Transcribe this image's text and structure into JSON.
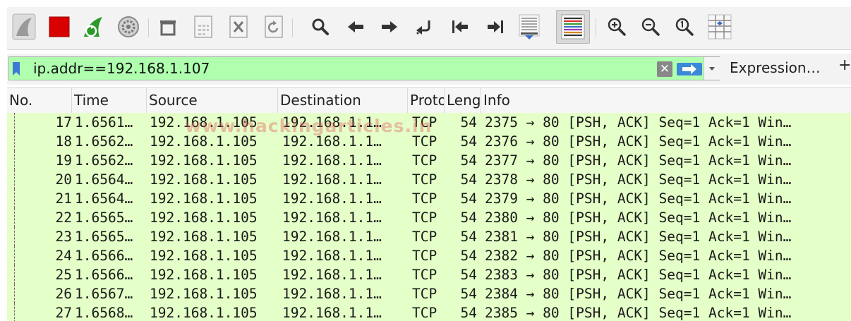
{
  "toolbar": {
    "buttons": [
      {
        "name": "start-capture-button",
        "icon": "shark-fin-icon"
      },
      {
        "name": "stop-capture-button",
        "icon": "stop-square-icon"
      },
      {
        "name": "restart-capture-button",
        "icon": "restart-fin-icon"
      },
      {
        "name": "capture-options-button",
        "icon": "gear-icon"
      },
      {
        "name": "open-file-button",
        "icon": "open-file-icon"
      },
      {
        "name": "save-file-button",
        "icon": "save-file-icon"
      },
      {
        "name": "close-file-button",
        "icon": "close-file-icon"
      },
      {
        "name": "reload-file-button",
        "icon": "reload-file-icon"
      },
      {
        "name": "find-packet-button",
        "icon": "search-icon"
      },
      {
        "name": "go-back-button",
        "icon": "arrow-left-icon"
      },
      {
        "name": "go-forward-button",
        "icon": "arrow-right-icon"
      },
      {
        "name": "go-to-packet-button",
        "icon": "go-to-packet-icon"
      },
      {
        "name": "first-packet-button",
        "icon": "first-packet-icon"
      },
      {
        "name": "last-packet-button",
        "icon": "last-packet-icon"
      },
      {
        "name": "autoscroll-button",
        "icon": "autoscroll-icon"
      },
      {
        "name": "colorize-button",
        "icon": "colorize-icon"
      },
      {
        "name": "zoom-in-button",
        "icon": "zoom-in-icon"
      },
      {
        "name": "zoom-out-button",
        "icon": "zoom-out-icon"
      },
      {
        "name": "normal-size-button",
        "icon": "zoom-reset-icon"
      },
      {
        "name": "resize-columns-button",
        "icon": "resize-columns-icon"
      }
    ],
    "colors": {
      "stop": "#d80000",
      "restart": "#2a9a2a",
      "fin": "#8a8a8a",
      "accent": "#3b6fc4"
    }
  },
  "filter": {
    "value": "ip.addr==192.168.1.107",
    "background": "#afffaf",
    "expression_label": "Expression…",
    "plus_label": "+"
  },
  "columns": [
    "No.",
    "Time",
    "Source",
    "Destination",
    "Proto",
    "Leng",
    "Info"
  ],
  "packets": [
    {
      "no": "17",
      "time": "1.6561…",
      "source": "192.168.1.105",
      "destination": "192.168.1.1…",
      "protocol": "TCP",
      "length": "54",
      "info": "2375 → 80 [PSH, ACK] Seq=1 Ack=1 Win…"
    },
    {
      "no": "18",
      "time": "1.6562…",
      "source": "192.168.1.105",
      "destination": "192.168.1.1…",
      "protocol": "TCP",
      "length": "54",
      "info": "2376 → 80 [PSH, ACK] Seq=1 Ack=1 Win…"
    },
    {
      "no": "19",
      "time": "1.6562…",
      "source": "192.168.1.105",
      "destination": "192.168.1.1…",
      "protocol": "TCP",
      "length": "54",
      "info": "2377 → 80 [PSH, ACK] Seq=1 Ack=1 Win…"
    },
    {
      "no": "20",
      "time": "1.6564…",
      "source": "192.168.1.105",
      "destination": "192.168.1.1…",
      "protocol": "TCP",
      "length": "54",
      "info": "2378 → 80 [PSH, ACK] Seq=1 Ack=1 Win…"
    },
    {
      "no": "21",
      "time": "1.6564…",
      "source": "192.168.1.105",
      "destination": "192.168.1.1…",
      "protocol": "TCP",
      "length": "54",
      "info": "2379 → 80 [PSH, ACK] Seq=1 Ack=1 Win…"
    },
    {
      "no": "22",
      "time": "1.6565…",
      "source": "192.168.1.105",
      "destination": "192.168.1.1…",
      "protocol": "TCP",
      "length": "54",
      "info": "2380 → 80 [PSH, ACK] Seq=1 Ack=1 Win…"
    },
    {
      "no": "23",
      "time": "1.6565…",
      "source": "192.168.1.105",
      "destination": "192.168.1.1…",
      "protocol": "TCP",
      "length": "54",
      "info": "2381 → 80 [PSH, ACK] Seq=1 Ack=1 Win…"
    },
    {
      "no": "24",
      "time": "1.6566…",
      "source": "192.168.1.105",
      "destination": "192.168.1.1…",
      "protocol": "TCP",
      "length": "54",
      "info": "2382 → 80 [PSH, ACK] Seq=1 Ack=1 Win…"
    },
    {
      "no": "25",
      "time": "1.6566…",
      "source": "192.168.1.105",
      "destination": "192.168.1.1…",
      "protocol": "TCP",
      "length": "54",
      "info": "2383 → 80 [PSH, ACK] Seq=1 Ack=1 Win…"
    },
    {
      "no": "26",
      "time": "1.6567…",
      "source": "192.168.1.105",
      "destination": "192.168.1.1…",
      "protocol": "TCP",
      "length": "54",
      "info": "2384 → 80 [PSH, ACK] Seq=1 Ack=1 Win…"
    },
    {
      "no": "27",
      "time": "1.6568…",
      "source": "192.168.1.105",
      "destination": "192.168.1.1…",
      "protocol": "TCP",
      "length": "54",
      "info": "2385 → 80 [PSH, ACK] Seq=1 Ack=1 Win…"
    }
  ],
  "row_color": "#e4ffc7",
  "watermark": "www.hackingarticles.in"
}
